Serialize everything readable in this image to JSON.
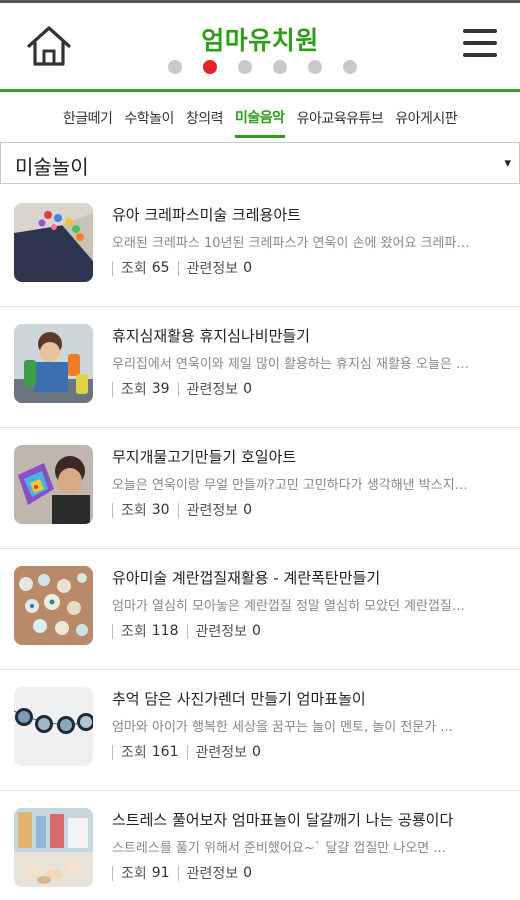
{
  "header": {
    "title": "엄마유치원",
    "home_icon": "home-icon",
    "menu_icon": "hamburger-menu-icon",
    "page_dots": 6,
    "active_dot": 1,
    "accent_color": "#2e9d1a",
    "active_dot_color": "#e8222c"
  },
  "tabs": [
    {
      "label": "한글떼기"
    },
    {
      "label": "수학놀이"
    },
    {
      "label": "창의력"
    },
    {
      "label": "미술음악",
      "active": true
    },
    {
      "label": "유아교육유튜브"
    },
    {
      "label": "유아게시판"
    }
  ],
  "category_select": {
    "value": "미술놀이",
    "arrow": "▾"
  },
  "posts": [
    {
      "title": "유아 크레파스미술 크레용아트",
      "desc": "오래된 크레파스 10년된 크레파스가 연욱이 손에 왔어요 크레파스가 ...",
      "views_label": "조회",
      "views": "65",
      "related_label": "관련정보",
      "related": "0"
    },
    {
      "title": "휴지심재활용 휴지심나비만들기",
      "desc": "우리집에서 연욱이와 제일 많이 활용하는 휴지심 재활용 오늘은 휴지심 ...",
      "views_label": "조회",
      "views": "39",
      "related_label": "관련정보",
      "related": "0"
    },
    {
      "title": "무지개물고기만들기 호일아트",
      "desc": "오늘은 연욱이랑 무얼 만들까?고민 고민하다가 생각해낸 박스지와 호일 ...",
      "views_label": "조회",
      "views": "30",
      "related_label": "관련정보",
      "related": "0"
    },
    {
      "title": "유아미술 계란껍질재활용 - 계란폭탄만들기",
      "desc": "엄마가 열심히 모아놓은 계란껍질 정말 열심히 모았던 계란껍질을 ...",
      "views_label": "조회",
      "views": "118",
      "related_label": "관련정보",
      "related": "0"
    },
    {
      "title": "추억 담은 사진가렌더 만들기 엄마표놀이",
      "desc": "엄마와 아이가 행복한 세상을 꿈꾸는 놀이 멘토, 놀이 전문가 ...",
      "views_label": "조회",
      "views": "161",
      "related_label": "관련정보",
      "related": "0"
    },
    {
      "title": "스트레스 풀어보자 엄마표놀이 달걀깨기 나는 공룡이다",
      "desc": "스트레스를 풀기 위해서 준비했어요~` 달걀 껍질만 나오면 ...",
      "views_label": "조회",
      "views": "91",
      "related_label": "관련정보",
      "related": "0"
    }
  ]
}
